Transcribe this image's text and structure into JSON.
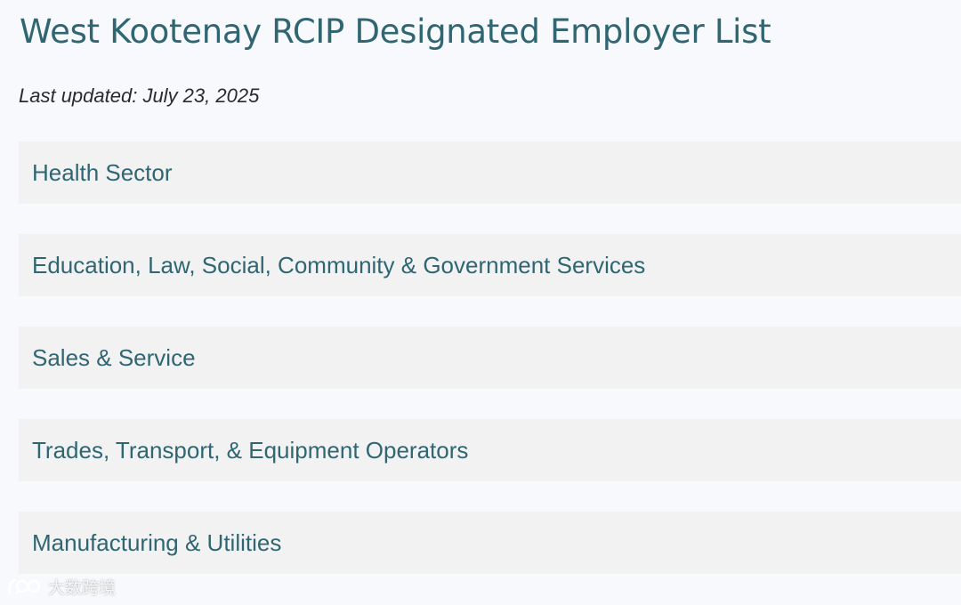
{
  "page": {
    "title": "West Kootenay RCIP Designated Employer List",
    "last_updated": "Last updated: July 23, 2025"
  },
  "accordion": {
    "sections": [
      {
        "label": "Health Sector"
      },
      {
        "label": "Education, Law, Social, Community & Government Services"
      },
      {
        "label": "Sales & Service"
      },
      {
        "label": "Trades, Transport, & Equipment Operators"
      },
      {
        "label": "Manufacturing & Utilities"
      }
    ]
  },
  "watermark": {
    "text": "大数跨境",
    "icon": "brand-logo-icon"
  },
  "colors": {
    "accent": "#2f6672",
    "background": "#f7f9fc",
    "panel": "#f2f2f2",
    "text": "#2b2b2b"
  }
}
